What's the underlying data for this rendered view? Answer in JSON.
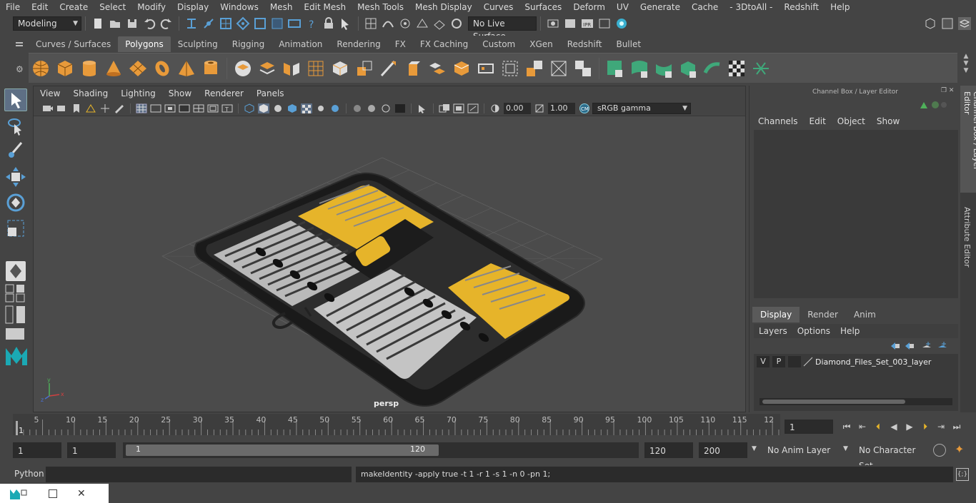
{
  "menubar": {
    "items": [
      "File",
      "Edit",
      "Create",
      "Select",
      "Modify",
      "Display",
      "Windows",
      "Mesh",
      "Edit Mesh",
      "Mesh Tools",
      "Mesh Display",
      "Curves",
      "Surfaces",
      "Deform",
      "UV",
      "Generate",
      "Cache",
      "- 3DtoAll -",
      "Redshift",
      "Help"
    ]
  },
  "statusline": {
    "mode": "Modeling",
    "live_surface": "No Live Surface"
  },
  "shelf": {
    "tabs": [
      "Curves / Surfaces",
      "Polygons",
      "Sculpting",
      "Rigging",
      "Animation",
      "Rendering",
      "FX",
      "FX Caching",
      "Custom",
      "XGen",
      "Redshift",
      "Bullet"
    ],
    "active_tab": "Polygons"
  },
  "viewport": {
    "menu": [
      "View",
      "Shading",
      "Lighting",
      "Show",
      "Renderer",
      "Panels"
    ],
    "exposure": "0.00",
    "gamma": "1.00",
    "colorspace": "sRGB gamma",
    "camera_label": "persp"
  },
  "channel_box": {
    "title": "Channel Box / Layer Editor",
    "menu": [
      "Channels",
      "Edit",
      "Object",
      "Show"
    ]
  },
  "layer_editor": {
    "tabs": [
      "Display",
      "Render",
      "Anim"
    ],
    "active_tab": "Display",
    "menu": [
      "Layers",
      "Options",
      "Help"
    ],
    "layers": [
      {
        "v": "V",
        "p": "P",
        "name": "Diamond_Files_Set_003_layer"
      }
    ]
  },
  "side_tabs": [
    "Channel Box / Layer Editor",
    "Attribute Editor"
  ],
  "timeline": {
    "ticks": [
      "5",
      "10",
      "15",
      "20",
      "25",
      "30",
      "35",
      "40",
      "45",
      "50",
      "55",
      "60",
      "65",
      "70",
      "75",
      "80",
      "85",
      "90",
      "95",
      "100",
      "105",
      "110",
      "115",
      "12"
    ],
    "start_marker": "1",
    "current_frame": "1"
  },
  "range": {
    "start": "1",
    "playback_start": "1",
    "slider_start": "1",
    "slider_end": "120",
    "playback_end": "120",
    "end": "200",
    "anim_layer": "No Anim Layer",
    "character_set": "No Character Set"
  },
  "cmdline": {
    "language": "Python",
    "result": "makeIdentity -apply true -t 1 -r 1 -s 1 -n 0 -pn 1;"
  },
  "colors": {
    "accent": "#5285a6",
    "shelf_green": "#3fa87a",
    "poly_orange": "#e89a3a",
    "zipper_yellow": "#e6b42a"
  }
}
